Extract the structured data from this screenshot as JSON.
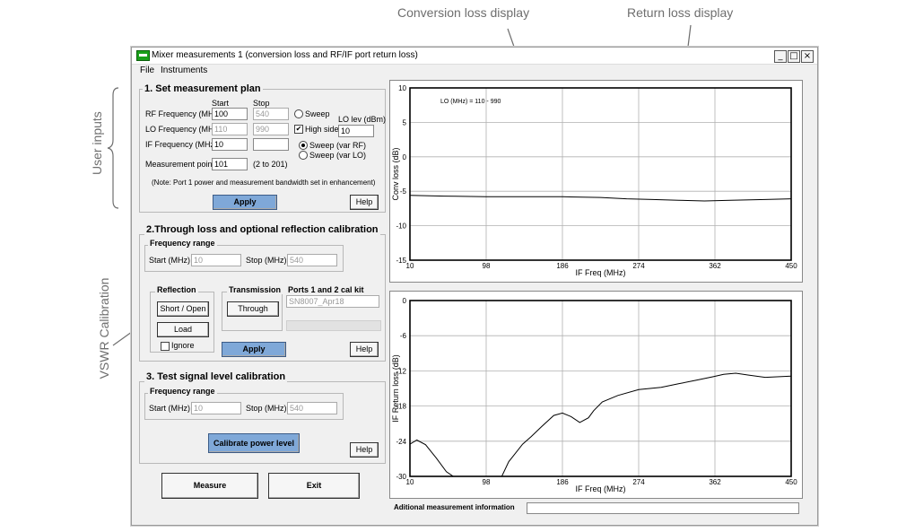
{
  "annotations": {
    "conversion_loss": "Conversion loss display",
    "return_loss": "Return loss display",
    "user_inputs": "User inputs",
    "vswr": "VSWR Calibration"
  },
  "window": {
    "title": "Mixer measurements 1 (conversion loss and RF/IF port return loss)",
    "controls": {
      "minimize": "_",
      "maximize": "□",
      "close": "×"
    }
  },
  "menu": {
    "file": "File",
    "instruments": "Instruments"
  },
  "plan": {
    "title": "1. Set measurement plan",
    "start_hdr": "Start",
    "stop_hdr": "Stop",
    "rf_label": "RF Frequency (MHz)",
    "rf_start": "100",
    "rf_stop": "540",
    "lo_label": "LO Frequency (MHz)",
    "lo_start": "110",
    "lo_stop": "990",
    "if_label": "IF Frequency (MHz)",
    "if_start": "10",
    "if_stop": "",
    "points_label": "Measurement points",
    "points_value": "101",
    "points_range": "(2 to 201)",
    "sweep_label": "Sweep",
    "highside_label": "High side",
    "highside_checked": "✔",
    "lolev_label": "LO lev (dBm)",
    "lolev_value": "10",
    "sweep_rf_label": "Sweep (var RF)",
    "sweep_lo_label": "Sweep (var LO)",
    "note": "(Note: Port 1 power and measurement bandwidth set in enhancement)",
    "apply": "Apply",
    "help": "Help"
  },
  "through": {
    "title": "2.Through loss and optional reflection calibration",
    "freq_range": "Frequency range",
    "start_label": "Start (MHz)",
    "start_value": "10",
    "stop_label": "Stop (MHz)",
    "stop_value": "540",
    "reflection": "Reflection",
    "short_open": "Short / Open",
    "load": "Load",
    "ignore": "Ignore",
    "transmission": "Transmission",
    "through_btn": "Through",
    "calkit_label": "Ports 1 and 2 cal kit",
    "calkit_value": "SN8007_Apr18",
    "apply": "Apply",
    "help": "Help"
  },
  "testsig": {
    "title": "3. Test signal level calibration",
    "freq_range": "Frequency range",
    "start_label": "Start (MHz)",
    "start_value": "10",
    "stop_label": "Stop (MHz)",
    "stop_value": "540",
    "calibrate": "Calibrate power level",
    "help": "Help"
  },
  "actions": {
    "measure": "Measure",
    "exit": "Exit"
  },
  "info": {
    "label": "Aditional measurement information",
    "value": ""
  },
  "chart_data": [
    {
      "type": "line",
      "annotation": "LO (MHz) = 110 - 990",
      "xlabel": "IF Freq (MHz)",
      "ylabel": "Conv loss (dB)",
      "xlim": [
        10,
        450
      ],
      "ylim": [
        -15,
        10
      ],
      "xticks": [
        "10",
        "98",
        "186",
        "274",
        "362",
        "450"
      ],
      "yticks": [
        "10",
        "5",
        "0",
        "-5",
        "-10",
        "-15"
      ],
      "grid": true,
      "series": [
        {
          "x": [
            10,
            50,
            98,
            140,
            186,
            230,
            260,
            290,
            320,
            350,
            380,
            420,
            450
          ],
          "y": [
            -5.6,
            -5.7,
            -5.8,
            -5.8,
            -5.8,
            -5.9,
            -6.1,
            -6.2,
            -6.3,
            -6.4,
            -6.3,
            -6.2,
            -6.1
          ]
        }
      ]
    },
    {
      "type": "line",
      "xlabel": "IF Freq (MHz)",
      "ylabel": "IF Return loss (dB)",
      "xlim": [
        10,
        450
      ],
      "ylim": [
        -30,
        0
      ],
      "xticks": [
        "10",
        "98",
        "186",
        "274",
        "362",
        "450"
      ],
      "yticks": [
        "0",
        "-6",
        "-12",
        "-18",
        "-24",
        "-30"
      ],
      "grid": true,
      "series": [
        {
          "x": [
            10,
            18,
            28,
            40,
            52,
            60,
            66,
            80,
            100,
            112,
            116,
            124,
            140,
            150,
            162,
            176,
            186,
            196,
            206,
            216,
            222,
            232,
            250,
            274,
            300,
            320,
            340,
            360,
            372,
            386,
            400,
            420,
            450
          ],
          "y": [
            -24.5,
            -23.8,
            -24.6,
            -26.8,
            -29.2,
            -30,
            -31,
            -31.5,
            -31.5,
            -30.8,
            -30,
            -27.5,
            -24.5,
            -23.2,
            -21.5,
            -19.6,
            -19.2,
            -19.8,
            -20.8,
            -20,
            -18.8,
            -17.3,
            -16.2,
            -15.2,
            -14.8,
            -14.2,
            -13.6,
            -13,
            -12.6,
            -12.4,
            -12.7,
            -13.1,
            -12.9
          ]
        }
      ]
    }
  ]
}
